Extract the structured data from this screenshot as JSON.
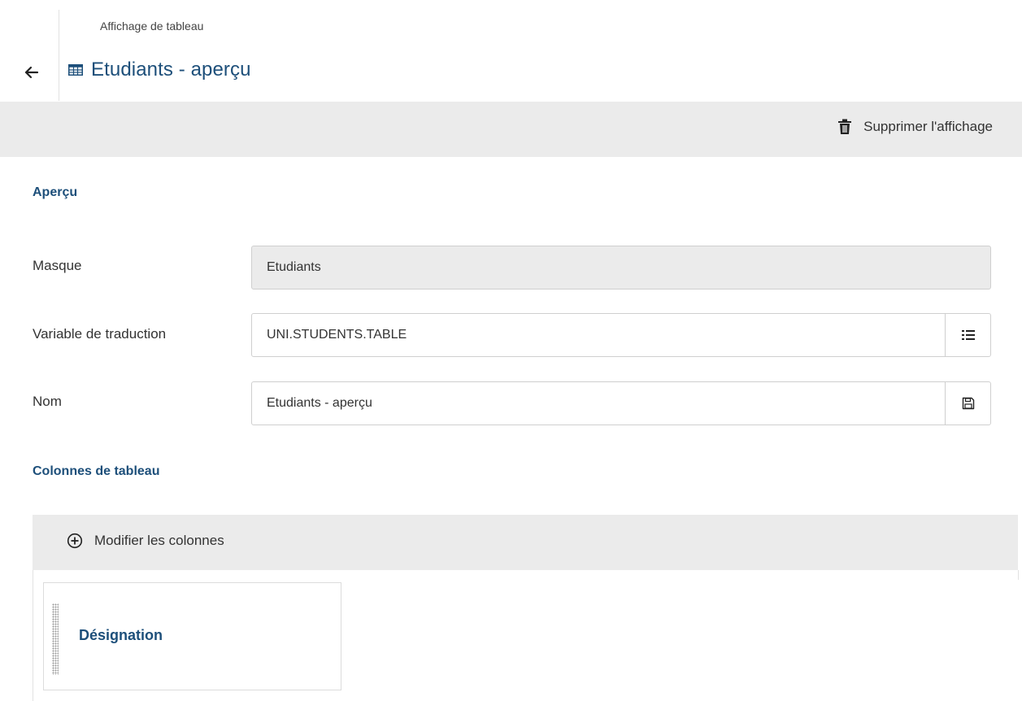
{
  "header": {
    "kicker": "Affichage de tableau",
    "title": "Etudiants - aperçu",
    "back_icon": "arrow-left-icon",
    "title_icon": "table-icon"
  },
  "toolbar": {
    "delete_label": "Supprimer l'affichage",
    "delete_icon": "trash-icon"
  },
  "overview": {
    "section_title": "Aperçu",
    "fields": [
      {
        "label": "Masque",
        "value": "Etudiants",
        "readonly": true
      },
      {
        "label": "Variable de traduction",
        "value": "UNI.STUDENTS.TABLE",
        "addon_icon": "list-icon"
      },
      {
        "label": "Nom",
        "value": "Etudiants - aperçu",
        "addon_icon": "save-icon"
      }
    ]
  },
  "columns": {
    "section_title": "Colonnes de tableau",
    "modify_label": "Modifier les colonnes",
    "modify_icon": "plus-circle-icon",
    "items": [
      {
        "label": "Désignation",
        "handle_icon": "drag-handle-icon"
      }
    ]
  },
  "colors": {
    "accent": "#1d4f7a",
    "bar_background": "#ebebeb",
    "text": "#333333"
  }
}
